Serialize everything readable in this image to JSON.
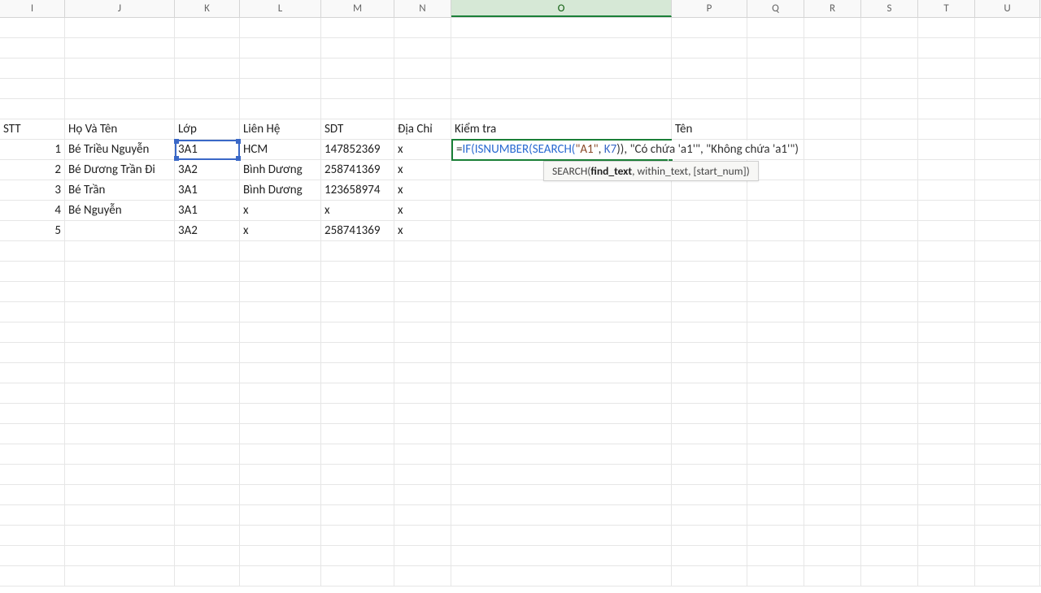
{
  "columns": [
    "I",
    "J",
    "K",
    "L",
    "M",
    "N",
    "O",
    "P",
    "Q",
    "R",
    "S",
    "T",
    "U"
  ],
  "selected_column": "O",
  "headers": {
    "I": "STT",
    "J": "Họ Và Tên",
    "K": "Lớp",
    "L": "Liên Hệ",
    "M": "SDT",
    "N": "Địa Chỉ",
    "O": "Kiểm tra",
    "P": "Tên"
  },
  "rows": [
    {
      "I": "1",
      "J": "Bé Triều Nguyễn",
      "K": "3A1",
      "L": "HCM",
      "M": "147852369",
      "N": "x"
    },
    {
      "I": "2",
      "J": "Bé Dương Trần Đi",
      "K": "3A2",
      "L": "Bình Dương",
      "M": "258741369",
      "N": "x"
    },
    {
      "I": "3",
      "J": "Bé Trần",
      "K": "3A1",
      "L": "Bình Dương",
      "M": "123658974",
      "N": "x"
    },
    {
      "I": "4",
      "J": "Bé Nguyễn",
      "K": "3A1",
      "L": "x",
      "M": "x",
      "N": "x"
    },
    {
      "I": "5",
      "J": "",
      "K": "3A2",
      "L": "x",
      "M": "258741369",
      "N": "x"
    }
  ],
  "formula": {
    "eq": "=",
    "if": "IF(",
    "isnum": "ISNUMBER(",
    "search": "SEARCH(",
    "arg1": "\"A1\"",
    "comma1": ", ",
    "ref": "K7",
    "close2": "))",
    "comma2": ", ",
    "res1": "\"Có chứa 'a1'\"",
    "comma3": ", ",
    "res2": "\"Không chứa 'a1'\"",
    "close1": ")"
  },
  "tooltip": {
    "fn": "SEARCH(",
    "p1": "find_text",
    "rest": ", within_text, [start_num])"
  }
}
